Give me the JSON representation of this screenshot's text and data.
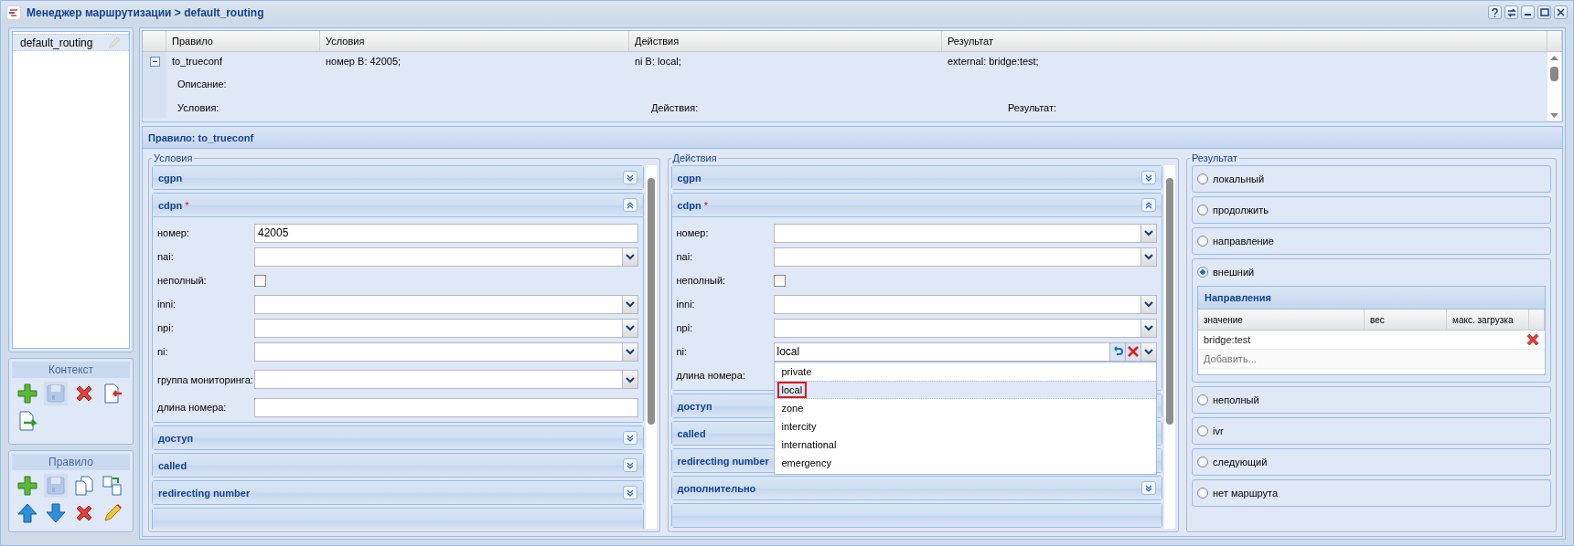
{
  "window": {
    "title": "Менеджер маршрутизации > default_routing"
  },
  "contexts": [
    {
      "name": "default_routing",
      "selected": true
    }
  ],
  "context_toolbar": {
    "title": "Контекст"
  },
  "rule_toolbar": {
    "title": "Правило"
  },
  "rules_grid": {
    "columns": [
      "Правило",
      "Условия",
      "Действия",
      "Результат"
    ],
    "rows": [
      {
        "expanded": true,
        "cells": [
          "to_trueconf",
          "номер B: 42005;",
          "ni B: local;",
          "external: bridge:test;"
        ],
        "details": {
          "description": "Описание:",
          "conditions": "Условия:",
          "actions": "Действия:",
          "result": "Результат:"
        }
      }
    ]
  },
  "rule_panel": {
    "title": "Правило: to_trueconf"
  },
  "conditions": {
    "legend": "Условия",
    "sections": [
      {
        "title": "cgpn",
        "expanded": false
      },
      {
        "title": "cdpn",
        "marker": "*",
        "expanded": true,
        "fields": [
          {
            "label": "номер:",
            "kind": "text",
            "value": "42005"
          },
          {
            "label": "nai:",
            "kind": "combo"
          },
          {
            "label": "неполный:",
            "kind": "checkbox",
            "checked": false
          },
          {
            "label": "inni:",
            "kind": "combo"
          },
          {
            "label": "npi:",
            "kind": "combo"
          },
          {
            "label": "ni:",
            "kind": "combo"
          },
          {
            "label": "группа мониторинга:",
            "kind": "combo"
          },
          {
            "label": "длина номера:",
            "kind": "text"
          }
        ]
      },
      {
        "title": "доступ",
        "expanded": false
      },
      {
        "title": "called",
        "expanded": false
      },
      {
        "title": "redirecting number",
        "expanded": false
      }
    ]
  },
  "actions": {
    "legend": "Действия",
    "sections": [
      {
        "title": "cgpn",
        "expanded": false
      },
      {
        "title": "cdpn",
        "marker": "*",
        "expanded": true,
        "fields": [
          {
            "label": "номер:",
            "kind": "combo"
          },
          {
            "label": "nai:",
            "kind": "combo"
          },
          {
            "label": "неполный:",
            "kind": "checkbox",
            "checked": false
          },
          {
            "label": "inni:",
            "kind": "combo"
          },
          {
            "label": "npi:",
            "kind": "combo"
          },
          {
            "label": "ni:",
            "kind": "combo",
            "value": "local",
            "clearable": true,
            "open": true,
            "options": [
              {
                "label": "private",
                "selected": false
              },
              {
                "label": "local",
                "selected": true
              },
              {
                "label": "zone",
                "selected": false
              },
              {
                "label": "intercity",
                "selected": false
              },
              {
                "label": "international",
                "selected": false
              },
              {
                "label": "emergency",
                "selected": false
              }
            ]
          },
          {
            "label": "длина номера:",
            "kind": "label"
          }
        ]
      },
      {
        "title": "доступ"
      },
      {
        "title": "called"
      },
      {
        "title": "redirecting number"
      },
      {
        "title": "дополнительно",
        "expanded": false
      }
    ]
  },
  "result": {
    "legend": "Результат",
    "options": [
      {
        "label": "локальный",
        "selected": false
      },
      {
        "label": "продолжить",
        "selected": false
      },
      {
        "label": "направление",
        "selected": false
      },
      {
        "label": "внешний",
        "selected": true,
        "grid": {
          "title": "Направления",
          "columns": [
            "значение",
            "вес",
            "макс. загрузка"
          ],
          "rows": [
            [
              "bridge:test"
            ]
          ],
          "placeholder": "Добавить..."
        }
      },
      {
        "label": "неполный",
        "selected": false
      },
      {
        "label": "ivr",
        "selected": false
      },
      {
        "label": "следующий",
        "selected": false
      },
      {
        "label": "нет маршрута",
        "selected": false
      }
    ]
  }
}
